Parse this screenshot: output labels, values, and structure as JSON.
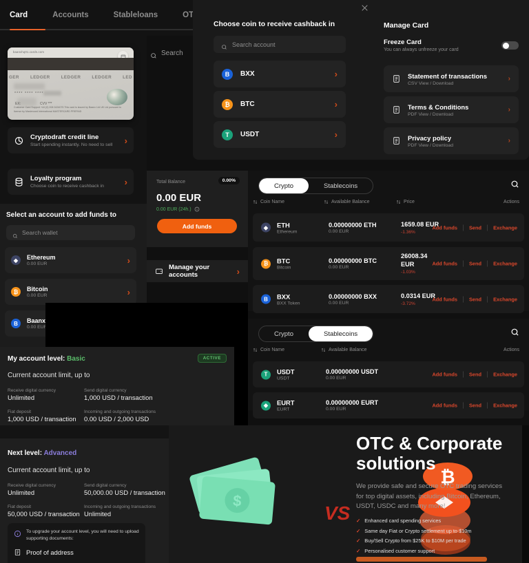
{
  "tabs": [
    {
      "label": "Card",
      "active": true
    },
    {
      "label": "Accounts",
      "active": false
    },
    {
      "label": "Stableloans",
      "active": false
    },
    {
      "label": "OTC",
      "active": false
    }
  ],
  "card": {
    "url_text": "baanxhq01.cards.com",
    "brand_marks": [
      "GER",
      "LEDGER",
      "LEDGER",
      "LEDGER",
      "LED"
    ],
    "number": "**** **** ****",
    "exp_label": "EX:",
    "cvv_label": "CVV ***",
    "footer": "Customer Card Support +44 (0) 208 0434075\nThis card is issued by Baanx Ltd UK Ltd pursuant to license by Mastercard International\nMASTERCARD  PREPAID"
  },
  "card_search": {
    "placeholder": "Search"
  },
  "left_cards": [
    {
      "title": "Cryptodraft credit line",
      "subtitle": "Start spending instantly. No need to sell",
      "icon": "cryptodraft-icon"
    },
    {
      "title": "Loyalty program",
      "subtitle": "Choose coin to receive cashback in",
      "icon": "coins-stack-icon"
    }
  ],
  "select_account": {
    "heading": "Select an account to add funds to",
    "search_placeholder": "Search wallet",
    "accounts": [
      {
        "name": "Ethereum",
        "balance": "0.00 EUR",
        "symbol": "E",
        "color": "#627eea"
      },
      {
        "name": "Bitcoin",
        "balance": "0.00 EUR",
        "symbol": "B",
        "color": "#f7931a"
      },
      {
        "name": "Baanx Token",
        "balance": "0.00 EUR",
        "symbol": "B",
        "color": "#1a62d8"
      }
    ]
  },
  "account_level": {
    "basic": {
      "title_prefix": "My account level:",
      "title_value": "Basic",
      "badge": "ACTIVE",
      "limit_heading": "Current account limit, up to",
      "limits": [
        {
          "key": "Receive digital currency",
          "value": "Unlimited"
        },
        {
          "key": "Send digital currency",
          "value": "1,000 USD / transaction"
        },
        {
          "key": "Fiat deposit",
          "value": "1,000 USD / transaction"
        },
        {
          "key": "Incoming and outgoing transactions",
          "value": "0.00 USD / 2,000 USD"
        }
      ]
    },
    "next": {
      "title_prefix": "Next level:",
      "title_value": "Advanced",
      "limit_heading": "Current account limit, up to",
      "limits": [
        {
          "key": "Receive digital currency",
          "value": "Unlimited"
        },
        {
          "key": "Send digital currency",
          "value": "50,000.00 USD / transaction"
        },
        {
          "key": "Fiat deposit",
          "value": "50,000 USD / transaction"
        },
        {
          "key": "Incoming and outgoing transactions",
          "value": "Unlimited"
        }
      ],
      "upgrade_note": "To upgrade your account level, you will need to upload supporting documents:",
      "upgrade_doc": "Proof of address"
    }
  },
  "balance": {
    "label": "Total Balance",
    "percent": "0.00%",
    "amount": "0.00 EUR",
    "change": "0.00 EUR (24h.)",
    "add_funds": "Add funds",
    "manage_accounts": "Manage your accounts"
  },
  "tables": [
    {
      "id": "crypto",
      "tabs": [
        {
          "label": "Crypto",
          "active": true
        },
        {
          "label": "Stablecoins",
          "active": false
        }
      ],
      "columns": [
        "Coin Name",
        "Available Balance",
        "Price",
        "Actions"
      ],
      "actions": [
        "Add funds",
        "Send",
        "Exchange"
      ],
      "rows": [
        {
          "symbol": "ETH",
          "full_name": "Ethereum",
          "balance": "0.00000000 ETH",
          "balance_fiat": "0.00 EUR",
          "price": "1659.08 EUR",
          "change": "-1.36%",
          "icon_color": "#627eea",
          "icon_letter": "E"
        },
        {
          "symbol": "BTC",
          "full_name": "Bitcoin",
          "balance": "0.00000000 BTC",
          "balance_fiat": "0.00 EUR",
          "price": "26008.34 EUR",
          "change": "-1.03%",
          "icon_color": "#f7931a",
          "icon_letter": "B"
        },
        {
          "symbol": "BXX",
          "full_name": "BXX Token",
          "balance": "0.00000000 BXX",
          "balance_fiat": "0.00 EUR",
          "price": "0.0314 EUR",
          "change": "-3.72%",
          "icon_color": "#1a62d8",
          "icon_letter": "B"
        }
      ]
    },
    {
      "id": "stablecoins",
      "tabs": [
        {
          "label": "Crypto",
          "active": false
        },
        {
          "label": "Stablecoins",
          "active": true
        }
      ],
      "columns": [
        "Coin Name",
        "Available Balance",
        "Actions"
      ],
      "actions": [
        "Add funds",
        "Send",
        "Exchange"
      ],
      "rows": [
        {
          "symbol": "USDT",
          "full_name": "USDT",
          "balance": "0.00000000 USDT",
          "balance_fiat": "0.00 EUR",
          "icon_color": "#1ba27a",
          "icon_letter": "T"
        },
        {
          "symbol": "EURT",
          "full_name": "EURT",
          "balance": "0.00000000 EURT",
          "balance_fiat": "0.00 EUR",
          "icon_color": "#1ba27a",
          "icon_letter": "E"
        }
      ]
    }
  ],
  "otc": {
    "heading": "OTC & Corporate solutions",
    "paragraph": "We provide safe and secure OTC trading services for top digital assets, including Bitcoin, Ethereum, USDT, USDC and many more!",
    "bullets": [
      "Enhanced card spending services",
      "Same day Fiat or Crypto settlement up to $10m",
      "Buy/Sell Crypto from $25K to $10M per trade",
      "Personalised customer support"
    ],
    "vs_label": "VS"
  },
  "modal": {
    "left_heading": "Choose coin to receive cashback in",
    "search_placeholder": "Search account",
    "coins": [
      {
        "name": "BXX",
        "color": "#1a62d8",
        "letter": "B"
      },
      {
        "name": "BTC",
        "color": "#f7931a",
        "letter": "B"
      },
      {
        "name": "USDT",
        "color": "#1ba27a",
        "letter": "T"
      }
    ],
    "right_heading": "Manage Card",
    "freeze": {
      "title": "Freeze Card",
      "subtitle": "You can always unfreeze your card",
      "enabled": false
    },
    "documents": [
      {
        "title": "Statement of transactions",
        "subtitle": "CSV View / Download"
      },
      {
        "title": "Terms & Conditions",
        "subtitle": "PDF View / Download"
      },
      {
        "title": "Privacy policy",
        "subtitle": "PDF View / Download"
      }
    ]
  },
  "colors": {
    "accent": "#f0600f",
    "action": "#d9472c",
    "negative": "#cf4432",
    "positive": "#4fae5d",
    "advanced": "#8b7ddb"
  }
}
